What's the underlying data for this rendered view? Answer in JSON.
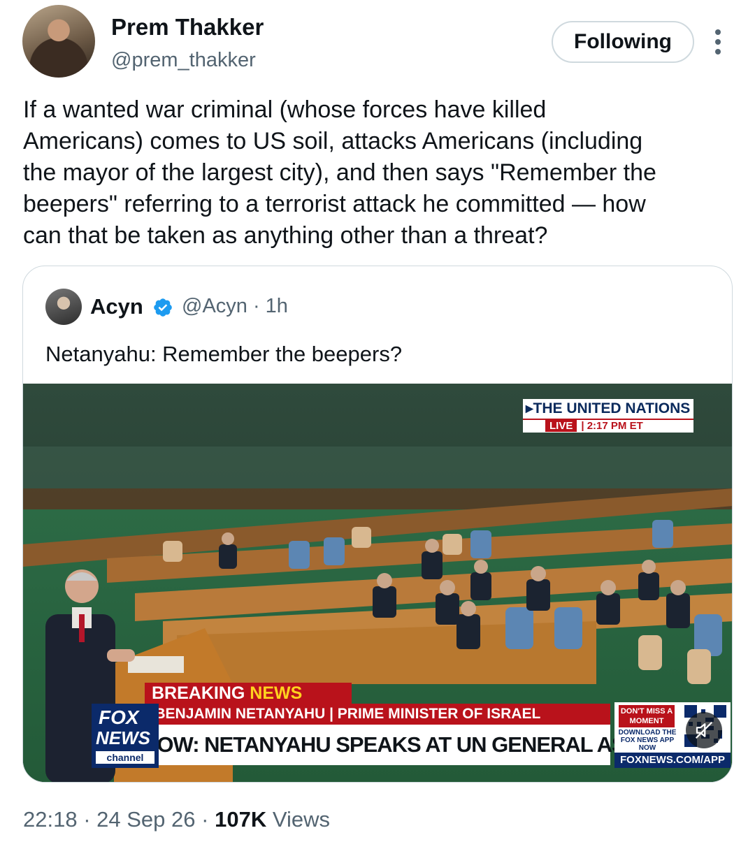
{
  "author": {
    "name": "Prem Thakker",
    "handle": "@prem_thakker",
    "follow_label": "Following"
  },
  "tweet": {
    "text": "If a wanted war criminal (whose forces have killed\nAmericans) comes to US soil, attacks Americans (including\nthe mayor of the largest city), and then says \"Remember the\nbeepers\" referring to a terrorist attack he committed — how\ncan that be taken as anything other than a threat?",
    "time": "22:18",
    "date": "24 Sep 26",
    "views_count": "107K",
    "views_label": "Views"
  },
  "quoted": {
    "name": "Acyn",
    "handle": "@Acyn · 1h",
    "text": "Netanyahu: Remember the beepers?"
  },
  "video": {
    "un_banner_title": "▸THE UNITED NATIONS",
    "live_label": "LIVE",
    "live_time": "| 2:17 PM ET",
    "breaking_1": "BREAKING",
    "breaking_2": "NEWS",
    "subtitle": "▸ BENJAMIN NETANYAHU | PRIME MINISTER OF ISRAEL",
    "headline": "NOW: NETANYAHU SPEAKS AT UN GENERAL ASSEMBLY",
    "fox_1": "FOX",
    "fox_2": "NEWS",
    "fox_3": "channel",
    "promo_top": "DON'T MISS A MOMENT",
    "promo_download": "DOWNLOAD THE FOX NEWS APP NOW",
    "promo_url": "FOXNEWS.COM/APP"
  },
  "icons": {
    "more": "more-options-icon",
    "verified": "verified-badge-icon",
    "mute": "muted-speaker-icon"
  },
  "colors": {
    "text_primary": "#0f1419",
    "text_secondary": "#536471",
    "border": "#cfd9de",
    "verified_blue": "#1d9bf0",
    "fox_red": "#b9121b",
    "fox_blue": "#0b2a6a"
  }
}
